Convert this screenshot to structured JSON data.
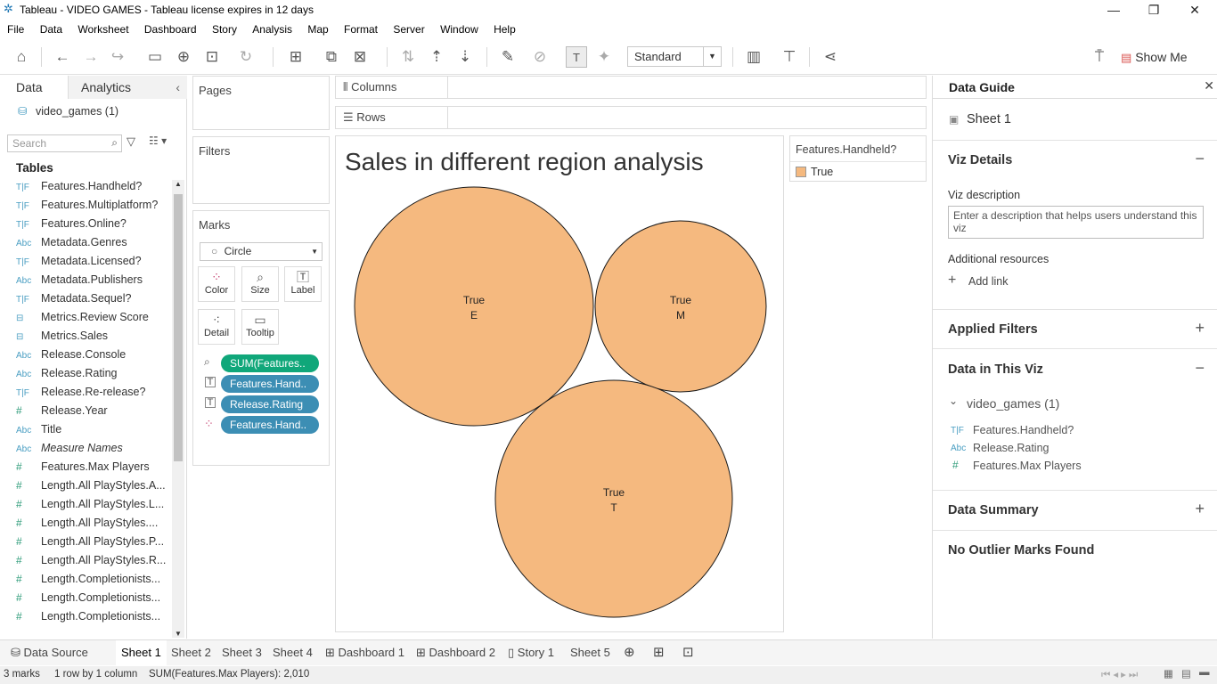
{
  "window": {
    "title": "Tableau - VIDEO GAMES - Tableau license expires in 12 days"
  },
  "menu": [
    "File",
    "Data",
    "Worksheet",
    "Dashboard",
    "Story",
    "Analysis",
    "Map",
    "Format",
    "Server",
    "Window",
    "Help"
  ],
  "toolbar": {
    "view_mode": "Standard",
    "show_me": "Show Me"
  },
  "leftpane": {
    "tab_data": "Data",
    "tab_analytics": "Analytics",
    "datasource": "video_games (1)",
    "search_placeholder": "Search",
    "tables_header": "Tables",
    "fields": [
      {
        "type": "T|F",
        "name": "Features.Handheld?"
      },
      {
        "type": "T|F",
        "name": "Features.Multiplatform?"
      },
      {
        "type": "T|F",
        "name": "Features.Online?"
      },
      {
        "type": "Abc",
        "name": "Metadata.Genres"
      },
      {
        "type": "T|F",
        "name": "Metadata.Licensed?"
      },
      {
        "type": "Abc",
        "name": "Metadata.Publishers"
      },
      {
        "type": "T|F",
        "name": "Metadata.Sequel?"
      },
      {
        "type": "cal",
        "name": "Metrics.Review Score"
      },
      {
        "type": "cal",
        "name": "Metrics.Sales"
      },
      {
        "type": "Abc",
        "name": "Release.Console"
      },
      {
        "type": "Abc",
        "name": "Release.Rating"
      },
      {
        "type": "T|F",
        "name": "Release.Re-release?"
      },
      {
        "type": "#",
        "name": "Release.Year"
      },
      {
        "type": "Abc",
        "name": "Title"
      },
      {
        "type": "Abc",
        "name": "Measure Names"
      },
      {
        "type": "#",
        "name": "Features.Max Players"
      },
      {
        "type": "#",
        "name": "Length.All PlayStyles.A..."
      },
      {
        "type": "#",
        "name": "Length.All PlayStyles.L..."
      },
      {
        "type": "#",
        "name": "Length.All PlayStyles...."
      },
      {
        "type": "#",
        "name": "Length.All PlayStyles.P..."
      },
      {
        "type": "#",
        "name": "Length.All PlayStyles.R..."
      },
      {
        "type": "#",
        "name": "Length.Completionists..."
      },
      {
        "type": "#",
        "name": "Length.Completionists..."
      },
      {
        "type": "#",
        "name": "Length.Completionists..."
      }
    ]
  },
  "cards": {
    "pages": "Pages",
    "filters": "Filters",
    "marks": "Marks",
    "mark_type": "Circle",
    "mark_buttons": [
      "Color",
      "Size",
      "Label",
      "Detail",
      "Tooltip"
    ],
    "pills": [
      "SUM(Features..",
      "Features.Hand..",
      "Release.Rating",
      "Features.Hand.."
    ]
  },
  "shelves": {
    "columns": "Columns",
    "rows": "Rows"
  },
  "viz": {
    "title": "Sales in different region analysis",
    "bubbles": [
      {
        "line1": "True",
        "line2": "E"
      },
      {
        "line1": "True",
        "line2": "M"
      },
      {
        "line1": "True",
        "line2": "T"
      }
    ],
    "fill_color": "#f5b97f"
  },
  "legend": {
    "title": "Features.Handheld?",
    "item": "True",
    "color": "#f5b97f"
  },
  "dataguide": {
    "title": "Data Guide",
    "sheet": "Sheet 1",
    "viz_details": "Viz Details",
    "viz_description_label": "Viz description",
    "viz_description_placeholder": "Enter a description that helps users understand this viz",
    "additional_resources": "Additional resources",
    "add_link": "Add link",
    "applied_filters": "Applied Filters",
    "data_in_viz": "Data in This Viz",
    "datasource": "video_games (1)",
    "fields": [
      {
        "type": "T|F",
        "name": "Features.Handheld?"
      },
      {
        "type": "Abc",
        "name": "Release.Rating"
      },
      {
        "type": "#",
        "name": "Features.Max Players"
      }
    ],
    "data_summary": "Data Summary",
    "outliers": "No Outlier Marks Found"
  },
  "bottom_tabs": [
    "Data Source",
    "Sheet 1",
    "Sheet 2",
    "Sheet 3",
    "Sheet 4",
    "Dashboard 1",
    "Dashboard 2",
    "Story 1",
    "Sheet 5"
  ],
  "status": {
    "marks": "3 marks",
    "dims": "1 row by 1 column",
    "sum": "SUM(Features.Max Players): 2,010"
  }
}
